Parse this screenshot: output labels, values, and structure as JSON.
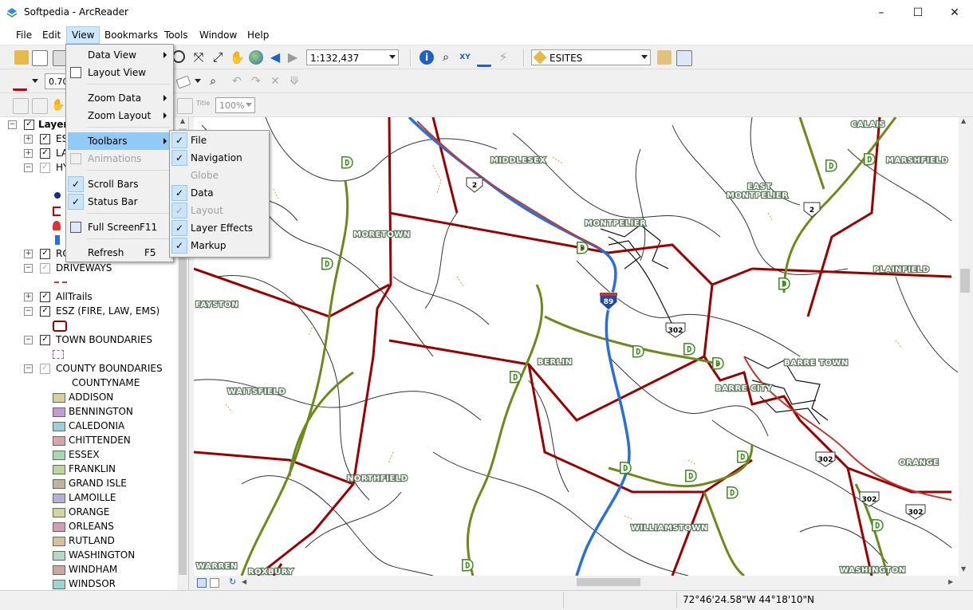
{
  "window": {
    "title": "Softpedia - ArcReader",
    "minimize": "–",
    "maximize": "☐",
    "close": "✕"
  },
  "menubar": [
    "File",
    "Edit",
    "View",
    "Bookmarks",
    "Tools",
    "Window",
    "Help"
  ],
  "toolbar": {
    "scale": "1:132,437",
    "layer": "ESITES",
    "line_width": "0.70",
    "zoom": "100%",
    "title_btn": "Title"
  },
  "view_menu": {
    "items": [
      {
        "label": "Data View"
      },
      {
        "label": "Layout View"
      },
      {
        "label": "Zoom Data"
      },
      {
        "label": "Zoom Layout"
      },
      {
        "label": "Toolbars"
      },
      {
        "label": "Animations"
      },
      {
        "label": "Scroll Bars"
      },
      {
        "label": "Status Bar"
      },
      {
        "label": "Full Screen",
        "shortcut": "F11"
      },
      {
        "label": "Refresh",
        "shortcut": "F5"
      }
    ]
  },
  "toolbars_menu": [
    "File",
    "Navigation",
    "Globe",
    "Data",
    "Layout",
    "Layer Effects",
    "Markup"
  ],
  "toc": {
    "root": "Layers",
    "rows": [
      "ES",
      "LA",
      "HY",
      "RO",
      "DRIVEWAYS",
      "AllTrails",
      "ESZ (FIRE, LAW, EMS)",
      "TOWN BOUNDARIES",
      "COUNTY BOUNDARIES",
      "COUNTYNAME"
    ],
    "counties": [
      {
        "name": "ADDISON",
        "color": "#d7d09c"
      },
      {
        "name": "BENNINGTON",
        "color": "#c89ad2"
      },
      {
        "name": "CALEDONIA",
        "color": "#9ccfd7"
      },
      {
        "name": "CHITTENDEN",
        "color": "#d7a6a6"
      },
      {
        "name": "ESSEX",
        "color": "#a8d7b4"
      },
      {
        "name": "FRANKLIN",
        "color": "#b9d79c"
      },
      {
        "name": "GRAND ISLE",
        "color": "#c3b39e"
      },
      {
        "name": "LAMOILLE",
        "color": "#b8b0d4"
      },
      {
        "name": "ORANGE",
        "color": "#d2d79c"
      },
      {
        "name": "ORLEANS",
        "color": "#d79cb4"
      },
      {
        "name": "RUTLAND",
        "color": "#d7c09c"
      },
      {
        "name": "WASHINGTON",
        "color": "#b6d7c6"
      },
      {
        "name": "WINDHAM",
        "color": "#c9a8a0"
      },
      {
        "name": "WINDSOR",
        "color": "#9cd7cf"
      }
    ]
  },
  "map": {
    "places": [
      "MIDDLESEX",
      "EAST",
      "MONTPELIER",
      "MARSHFIELD",
      "CALAIS",
      "MORETOWN",
      "MONTPELIER",
      "PLAINFIELD",
      "FAYSTON",
      "BERLIN",
      "BARRE TOWN",
      "BARRE CITY",
      "WAITSFIELD",
      "NORTHFIELD",
      "ORANGE",
      "WILLIAMSTOWN",
      "WARREN",
      "ROXBURY",
      "WASHINGTON"
    ],
    "shields": [
      "2",
      "2",
      "89",
      "302",
      "302",
      "302",
      "302"
    ]
  },
  "status": {
    "coords": "72°46'24.58\"W  44°18'10\"N"
  }
}
